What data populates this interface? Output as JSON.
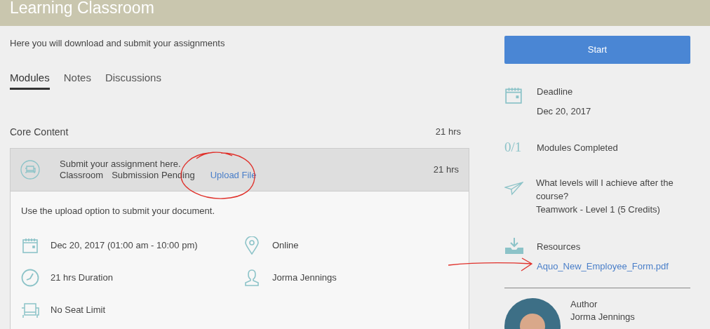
{
  "header": {
    "title": "Learning Classroom"
  },
  "intro": "Here you will download and submit your assignments",
  "tabs": [
    {
      "label": "Modules",
      "selected": true
    },
    {
      "label": "Notes",
      "selected": false
    },
    {
      "label": "Discussions",
      "selected": false
    }
  ],
  "section": {
    "title": "Core Content",
    "duration": "21 hrs"
  },
  "module": {
    "title": "Submit your assignment here.",
    "type": "Classroom",
    "status": "Submission Pending",
    "action": "Upload File",
    "duration": "21 hrs",
    "description": "Use the upload option to submit your document.",
    "details": [
      {
        "kind": "date",
        "text": "Dec 20, 2017 (01:00 am - 10:00 pm)"
      },
      {
        "kind": "location",
        "text": "Online"
      },
      {
        "kind": "duration",
        "text": "21 hrs Duration"
      },
      {
        "kind": "instructor",
        "text": "Jorma Jennings"
      },
      {
        "kind": "seats",
        "text": "No Seat Limit"
      }
    ]
  },
  "sidebar": {
    "start_button": "Start",
    "deadline": {
      "label": "Deadline",
      "date": "Dec 20, 2017"
    },
    "progress": {
      "count": "0/1",
      "label": "Modules Completed"
    },
    "levels": {
      "question": "What levels will I achieve after the course?",
      "answer": "Teamwork - Level 1 (5 Credits)"
    },
    "resources": {
      "label": "Resources",
      "file": "Aquo_New_Employee_Form.pdf"
    },
    "author": {
      "label": "Author",
      "name": "Jorma Jennings"
    }
  }
}
